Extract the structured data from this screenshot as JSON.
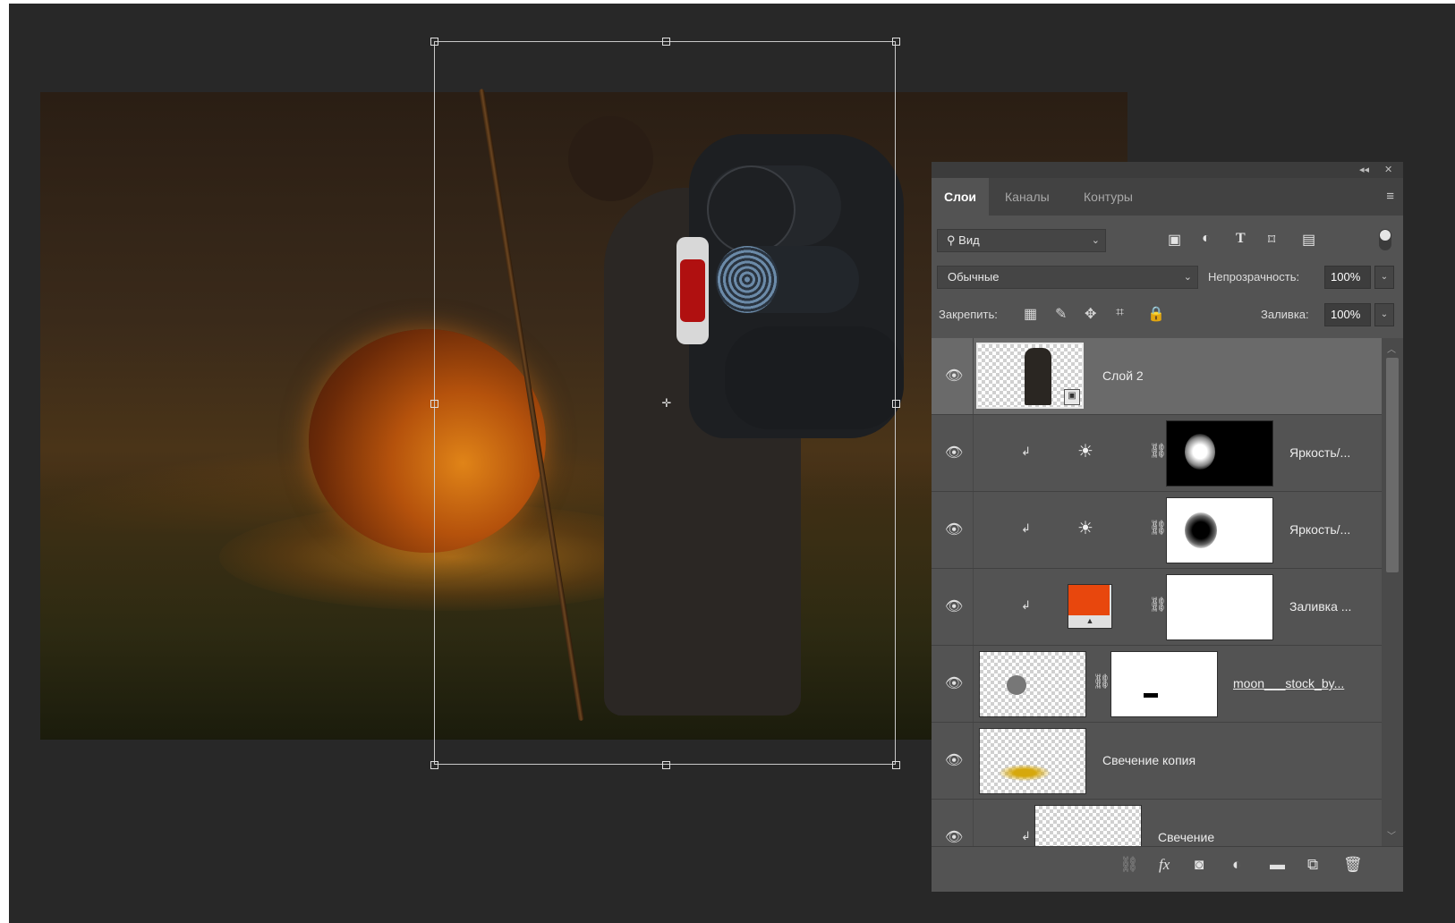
{
  "panel": {
    "collapse_icon": "double-chevron-left-icon",
    "close_icon": "close-icon",
    "tabs": [
      {
        "label": "Слои",
        "active": true
      },
      {
        "label": "Каналы",
        "active": false
      },
      {
        "label": "Контуры",
        "active": false
      }
    ],
    "filter": {
      "label": "Вид",
      "icon": "search-icon"
    },
    "filter_icons": [
      "image-filter-icon",
      "adjustment-filter-icon",
      "type-filter-icon",
      "shape-filter-icon",
      "smart-object-filter-icon"
    ],
    "blend_mode": "Обычные",
    "opacity_label": "Непрозрачность:",
    "opacity_value": "100%",
    "lock_label": "Закрепить:",
    "fill_label": "Заливка:",
    "fill_value": "100%",
    "lock_icons": [
      "lock-transparent-pixels-icon",
      "lock-image-pixels-icon",
      "lock-position-icon",
      "lock-artboard-icon",
      "lock-all-icon"
    ]
  },
  "layers": [
    {
      "name": "Слой 2",
      "type": "smart-object",
      "selected": true
    },
    {
      "name": "Яркость/...",
      "type": "adjustment",
      "clipped": true
    },
    {
      "name": "Яркость/...",
      "type": "adjustment",
      "clipped": true
    },
    {
      "name": "Заливка ...",
      "type": "fill",
      "clipped": true,
      "fill_color": "#e8470d"
    },
    {
      "name": "moon___stock_by...",
      "type": "masked-image"
    },
    {
      "name": "Свечение копия",
      "type": "image"
    },
    {
      "name": "Свечение",
      "type": "image",
      "clipped": true
    }
  ],
  "bottom_bar_icons": [
    "link-layers-icon",
    "fx-icon",
    "add-mask-icon",
    "new-adjustment-icon",
    "new-group-icon",
    "new-layer-icon",
    "delete-icon"
  ],
  "colors": {
    "workspace": "#282828",
    "panel": "#535353",
    "selected_layer": "#6a6a6a",
    "fill_swatch": "#e8470d"
  }
}
